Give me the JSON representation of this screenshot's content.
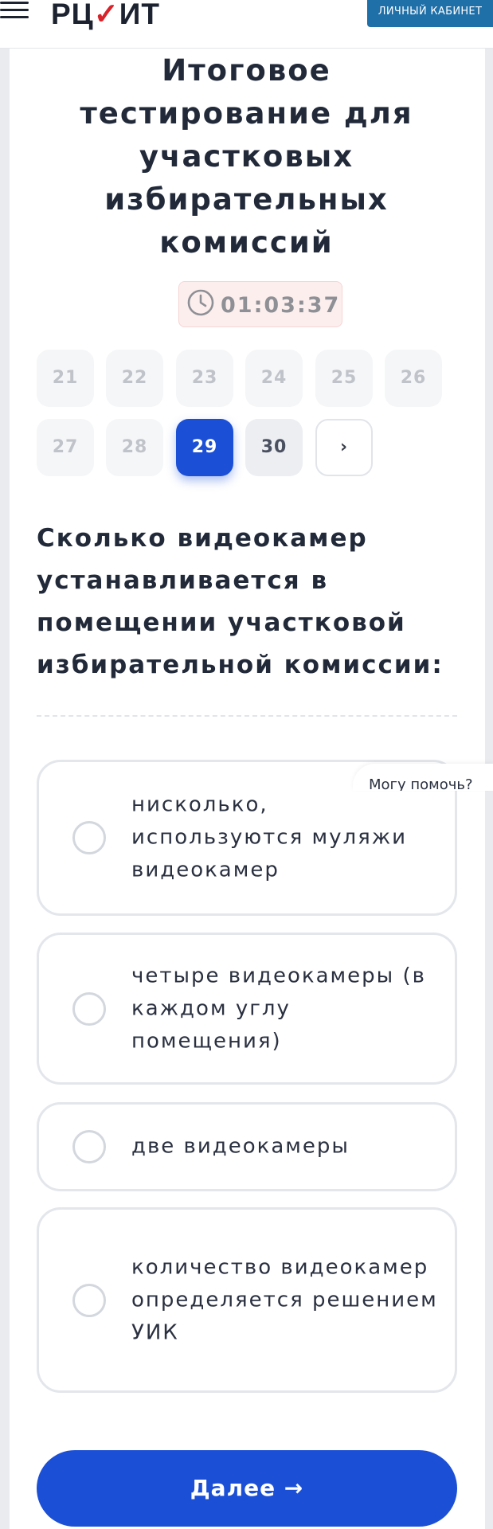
{
  "header": {
    "menu_icon": "hamburger-menu-icon",
    "logo_left": "РЦ",
    "logo_check": "✓",
    "logo_right": "ИТ",
    "cabinet_label": "ЛИЧНЫЙ КАБИНЕТ",
    "accent_color": "#1f6fa8"
  },
  "test": {
    "title": "Итоговое тестирование для участковых избирательных комиссий",
    "timer": "01:03:37",
    "timer_icon": "clock-icon"
  },
  "navigation": {
    "questions": [
      "21",
      "22",
      "23",
      "24",
      "25",
      "26",
      "27",
      "28",
      "29",
      "30"
    ],
    "current": "29",
    "next_arrow": "›"
  },
  "question": {
    "text": "Сколько видеокамер устанавливается в помещении участковой избирательной комиссии:"
  },
  "answers": [
    "нисколько, используются муляжи видеокамер",
    "четыре видеокамеры (в каждом углу помещения)",
    "две видеокамеры",
    "количество видеокамер определяется решением УИК"
  ],
  "help_widget": {
    "label": "Могу помочь?"
  },
  "actions": {
    "next_label": "Далее →",
    "primary_color": "#1b4fd6"
  }
}
